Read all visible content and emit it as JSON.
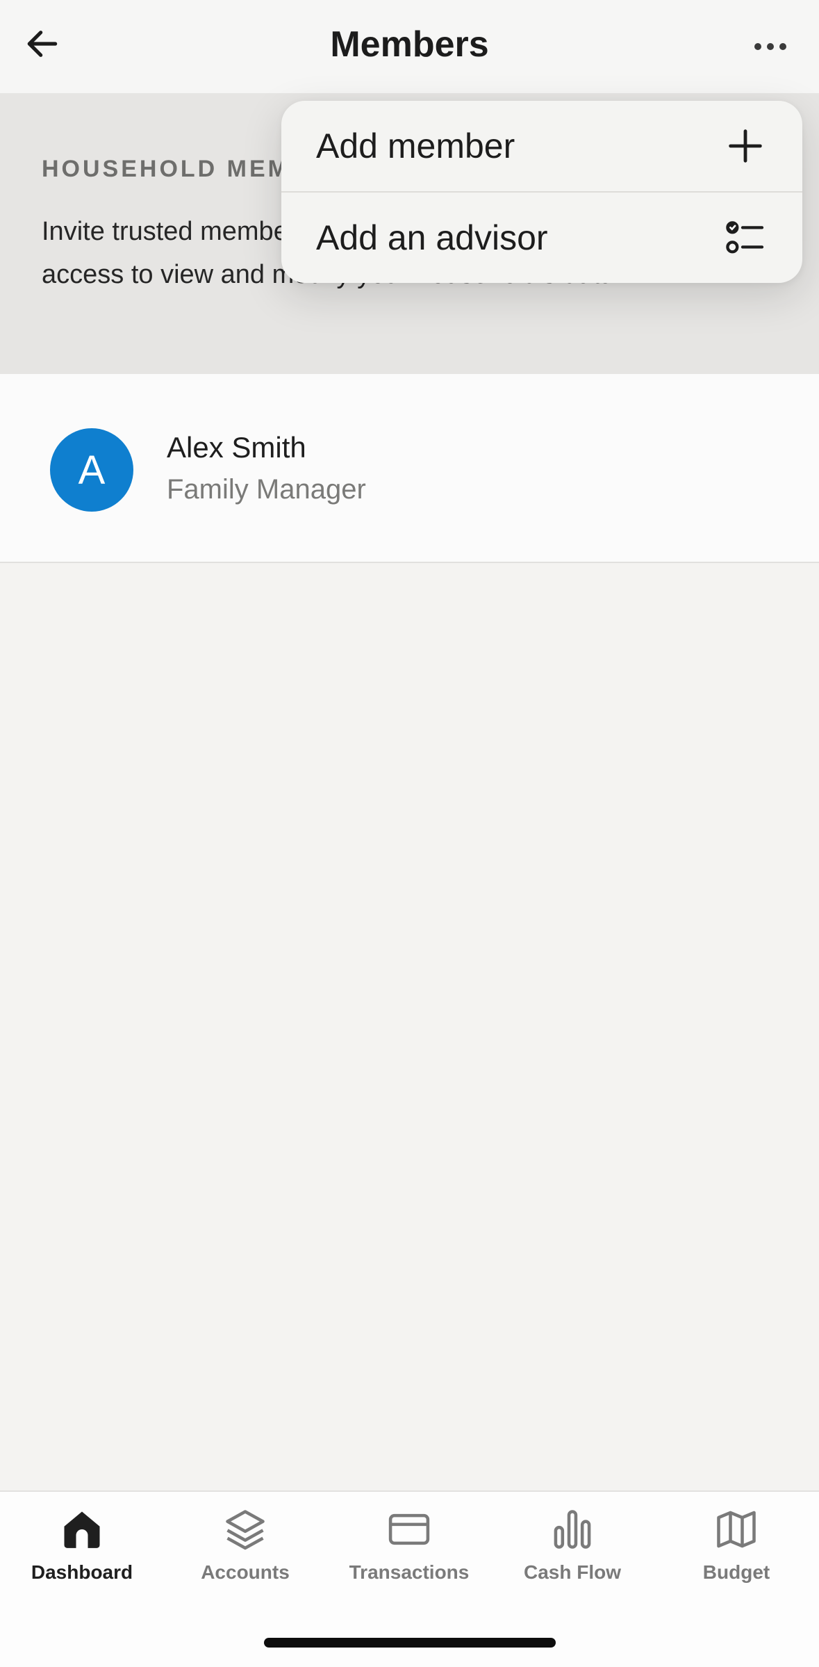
{
  "header": {
    "title": "Members",
    "back_icon": "arrow-left-icon",
    "more_icon": "more-horizontal-icon"
  },
  "household": {
    "section_label": "HOUSEHOLD MEMBERS",
    "description": "Invite trusted members to your household. They'll have full access to view and modify your household's data."
  },
  "members": [
    {
      "initial": "A",
      "name": "Alex Smith",
      "role": "Family Manager",
      "avatar_color": "#0f7fcf"
    }
  ],
  "menu": {
    "items": [
      {
        "label": "Add member",
        "icon": "plus-icon"
      },
      {
        "label": "Add an advisor",
        "icon": "checklist-icon"
      }
    ]
  },
  "tabbar": {
    "active": "Dashboard",
    "tabs": [
      {
        "label": "Dashboard",
        "icon": "home-icon"
      },
      {
        "label": "Accounts",
        "icon": "layers-icon"
      },
      {
        "label": "Transactions",
        "icon": "credit-card-icon"
      },
      {
        "label": "Cash Flow",
        "icon": "bar-chart-icon"
      },
      {
        "label": "Budget",
        "icon": "map-icon"
      }
    ]
  }
}
